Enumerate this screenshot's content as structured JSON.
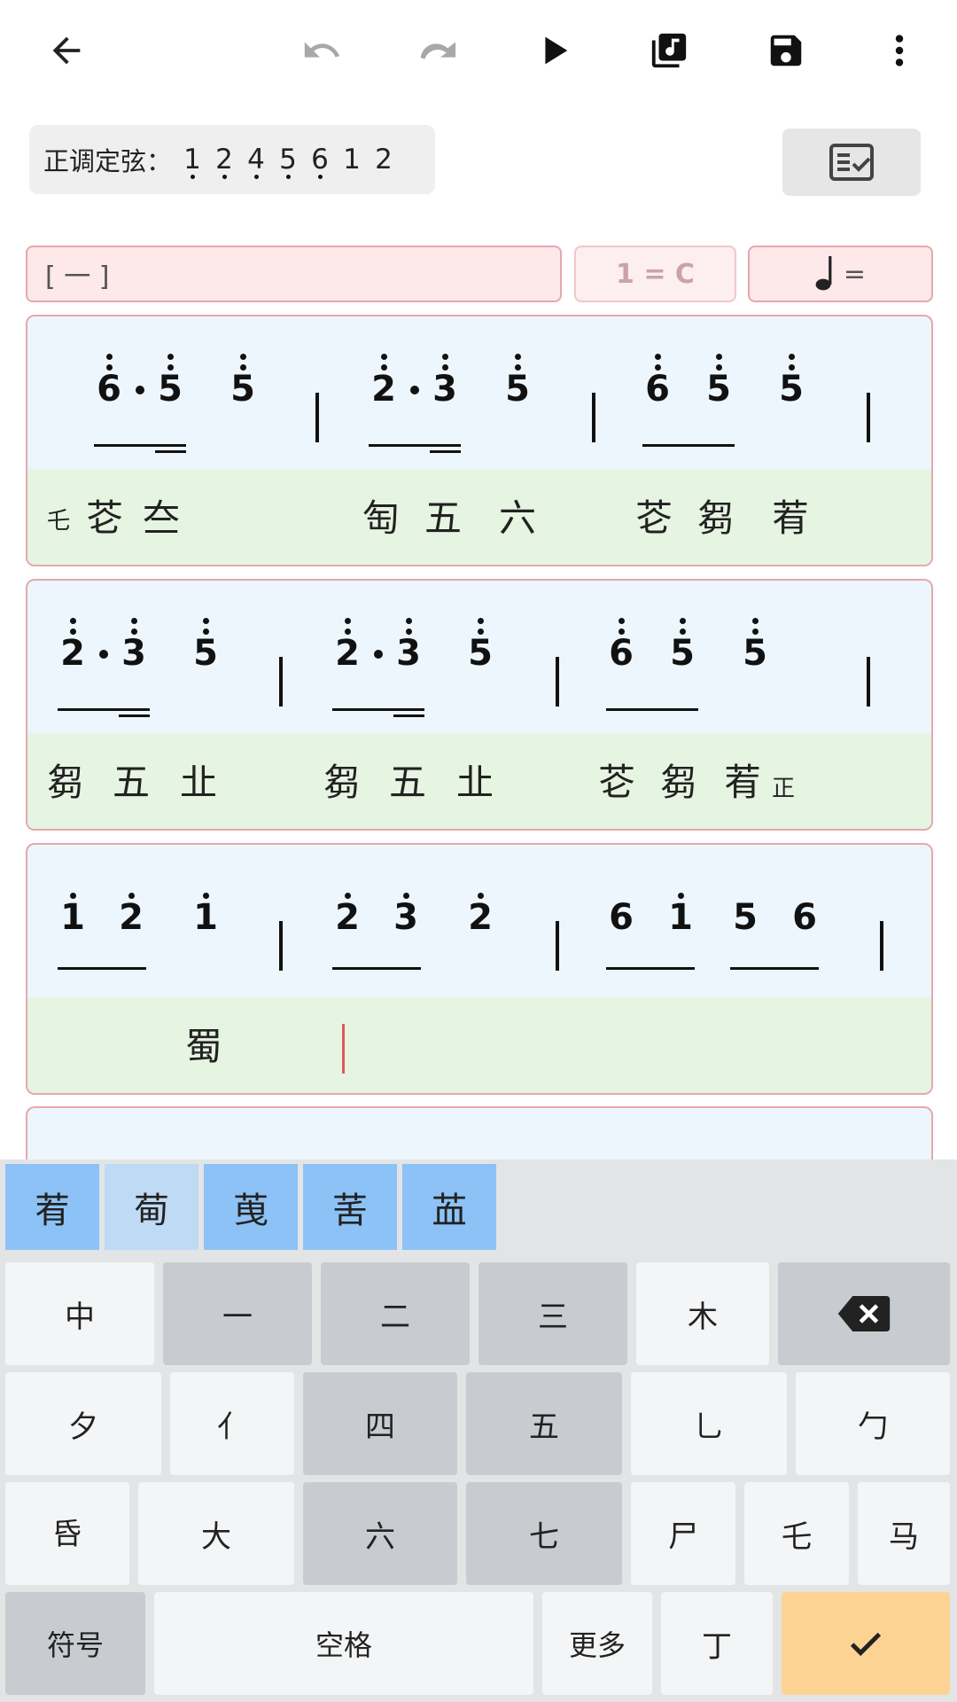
{
  "toolbar": {
    "icons": [
      "arrow-left-icon",
      "undo-icon",
      "redo-icon",
      "play-icon",
      "music-library-icon",
      "save-icon",
      "more-vert-icon"
    ]
  },
  "tuning": {
    "label": "正调定弦：",
    "notes": [
      "1",
      "2",
      "4",
      "5",
      "6",
      "1",
      "2"
    ]
  },
  "header": {
    "section": "[ 一 ]",
    "key": "1 = C",
    "tempo": "="
  },
  "score": {
    "rows": [
      {
        "notes": [
          "6",
          "5",
          "5",
          "2",
          "3",
          "5",
          "6",
          "5",
          "5"
        ],
        "tab": [
          "乇",
          "芲",
          "夳",
          "匋",
          "五",
          "六",
          "芲",
          "芻",
          "䒴"
        ]
      },
      {
        "notes": [
          "2",
          "3",
          "5",
          "2",
          "3",
          "5",
          "6",
          "5",
          "5"
        ],
        "tab": [
          "芻",
          "五",
          "㐀",
          "芻",
          "五",
          "㐀",
          "芲",
          "芻",
          "䒴",
          "正"
        ]
      },
      {
        "notes": [
          "1",
          "2",
          "1",
          "2",
          "3",
          "2",
          "6",
          "1",
          "5",
          "6"
        ],
        "tab": [
          "蜀"
        ]
      }
    ]
  },
  "keyboard": {
    "candidates": [
      "䒴",
      "䓒",
      "䒶",
      "䒷",
      "䒸"
    ],
    "row1": [
      "中",
      "一",
      "二",
      "三",
      "木"
    ],
    "row2": [
      "夕",
      "亻",
      "四",
      "五",
      "乚",
      "勹"
    ],
    "row3": [
      "𠯑",
      "大",
      "六",
      "七",
      "尸",
      "乇",
      "马"
    ],
    "row4": {
      "symbols": "符号",
      "space": "空格",
      "more": "更多",
      "ding": "丁"
    },
    "icons": [
      "backspace-icon",
      "check-icon"
    ],
    "accent_color": "#fdd394",
    "candidate_color": "#8cc2f6"
  }
}
